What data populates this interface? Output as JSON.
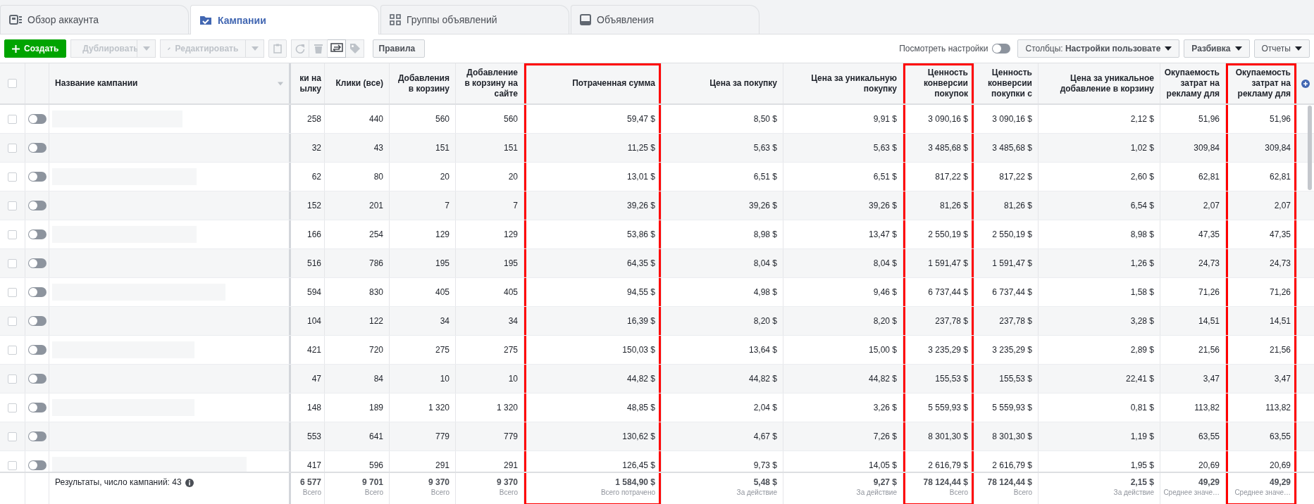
{
  "tabs": [
    {
      "label": "Обзор аккаунта",
      "selected": false,
      "kind": "overview"
    },
    {
      "label": "Кампании",
      "selected": true,
      "kind": "folder"
    },
    {
      "label": "Группы объявлений",
      "selected": false,
      "kind": "grid"
    },
    {
      "label": "Объявления",
      "selected": false,
      "kind": "ad"
    }
  ],
  "toolbar": {
    "create": "Создать",
    "duplicate": {
      "label": "Дублировать",
      "disabled": true
    },
    "edit": {
      "label": "Редактировать",
      "disabled": true
    },
    "rules": "Правила",
    "view_settings": {
      "label": "Посмотреть настройки",
      "on": false
    },
    "columns": "Столбцы: **Настройки пользовате**",
    "breakdown": "Разбивка",
    "reports": "Отчеты"
  },
  "table": {
    "select_all": {
      "checked": false
    },
    "name_header": "Название кампании",
    "columns": [
      {
        "header": "ки на ылку",
        "highlighted": false
      },
      {
        "header": "Клики (все)",
        "highlighted": false
      },
      {
        "header": "Добавления в корзину",
        "highlighted": false
      },
      {
        "header": "Добавление в корзину на сайте",
        "highlighted": false
      },
      {
        "header": "Потраченная сумма",
        "highlighted": true
      },
      {
        "header": "Цена за покупку",
        "highlighted": false
      },
      {
        "header": "Цена за уникальную покупку",
        "highlighted": false
      },
      {
        "header": "Ценность конверсии покупок",
        "highlighted": true
      },
      {
        "header": "Ценность конверсии покупки с",
        "highlighted": false
      },
      {
        "header": "Цена за уникальное добавление в корзину",
        "highlighted": false
      },
      {
        "header": "Окупаемость затрат на рекламу для",
        "highlighted": false
      },
      {
        "header": "Окупаемость затрат на рекламу для",
        "highlighted": true
      }
    ],
    "rows": [
      {
        "checked": false,
        "on": false,
        "cells": [
          "258",
          "440",
          "560",
          "560",
          "59,47 $",
          "8,50 $",
          "9,91 $",
          "3 090,16 $",
          "3 090,16 $",
          "2,12 $",
          "51,96",
          "51,96"
        ]
      },
      {
        "checked": false,
        "on": false,
        "cells": [
          "32",
          "43",
          "151",
          "151",
          "11,25 $",
          "5,63 $",
          "5,63 $",
          "3 485,68 $",
          "3 485,68 $",
          "1,02 $",
          "309,84",
          "309,84"
        ]
      },
      {
        "checked": false,
        "on": false,
        "cells": [
          "62",
          "80",
          "20",
          "20",
          "13,01 $",
          "6,51 $",
          "6,51 $",
          "817,22 $",
          "817,22 $",
          "2,60 $",
          "62,81",
          "62,81"
        ]
      },
      {
        "checked": false,
        "on": false,
        "cells": [
          "152",
          "201",
          "7",
          "7",
          "39,26 $",
          "39,26 $",
          "39,26 $",
          "81,26 $",
          "81,26 $",
          "6,54 $",
          "2,07",
          "2,07"
        ]
      },
      {
        "checked": false,
        "on": false,
        "cells": [
          "166",
          "254",
          "129",
          "129",
          "53,86 $",
          "8,98 $",
          "13,47 $",
          "2 550,19 $",
          "2 550,19 $",
          "8,98 $",
          "47,35",
          "47,35"
        ]
      },
      {
        "checked": false,
        "on": false,
        "cells": [
          "516",
          "786",
          "195",
          "195",
          "64,35 $",
          "8,04 $",
          "8,04 $",
          "1 591,47 $",
          "1 591,47 $",
          "1,26 $",
          "24,73",
          "24,73"
        ]
      },
      {
        "checked": false,
        "on": false,
        "cells": [
          "594",
          "830",
          "405",
          "405",
          "94,55 $",
          "4,98 $",
          "9,46 $",
          "6 737,44 $",
          "6 737,44 $",
          "1,58 $",
          "71,26",
          "71,26"
        ]
      },
      {
        "checked": false,
        "on": false,
        "cells": [
          "104",
          "122",
          "34",
          "34",
          "16,39 $",
          "8,20 $",
          "8,20 $",
          "237,78 $",
          "237,78 $",
          "3,28 $",
          "14,51",
          "14,51"
        ]
      },
      {
        "checked": false,
        "on": false,
        "cells": [
          "421",
          "720",
          "275",
          "275",
          "150,03 $",
          "13,64 $",
          "15,00 $",
          "3 235,29 $",
          "3 235,29 $",
          "2,89 $",
          "21,56",
          "21,56"
        ]
      },
      {
        "checked": false,
        "on": false,
        "cells": [
          "47",
          "84",
          "10",
          "10",
          "44,82 $",
          "44,82 $",
          "44,82 $",
          "155,53 $",
          "155,53 $",
          "22,41 $",
          "3,47",
          "3,47"
        ]
      },
      {
        "checked": false,
        "on": false,
        "cells": [
          "148",
          "189",
          "1 320",
          "1 320",
          "48,85 $",
          "2,04 $",
          "3,26 $",
          "5 559,93 $",
          "5 559,93 $",
          "0,81 $",
          "113,82",
          "113,82"
        ]
      },
      {
        "checked": false,
        "on": false,
        "cells": [
          "553",
          "641",
          "779",
          "779",
          "130,62 $",
          "4,67 $",
          "7,26 $",
          "8 301,30 $",
          "8 301,30 $",
          "1,19 $",
          "63,55",
          "63,55"
        ]
      },
      {
        "checked": false,
        "on": false,
        "cells": [
          "417",
          "596",
          "291",
          "291",
          "126,45 $",
          "9,73 $",
          "14,05 $",
          "2 616,79 $",
          "2 616,79 $",
          "1,95 $",
          "20,69",
          "20,69"
        ]
      }
    ],
    "footer": {
      "label": "Результаты, число кампаний: 43",
      "totals": [
        {
          "value": "6 577",
          "label": "Всего"
        },
        {
          "value": "9 701",
          "label": "Всего"
        },
        {
          "value": "9 370",
          "label": "Всего"
        },
        {
          "value": "9 370",
          "label": "Всего"
        },
        {
          "value": "1 584,90 $",
          "label": "Всего потрачено"
        },
        {
          "value": "5,48 $",
          "label": "За действие"
        },
        {
          "value": "9,27 $",
          "label": "За действие"
        },
        {
          "value": "78 124,44 $",
          "label": "Всего"
        },
        {
          "value": "78 124,44 $",
          "label": "Всего"
        },
        {
          "value": "2,15 $",
          "label": "За действие"
        },
        {
          "value": "49,29",
          "label": "Среднее значе…"
        },
        {
          "value": "49,29",
          "label": "Среднее значе…"
        }
      ]
    }
  }
}
